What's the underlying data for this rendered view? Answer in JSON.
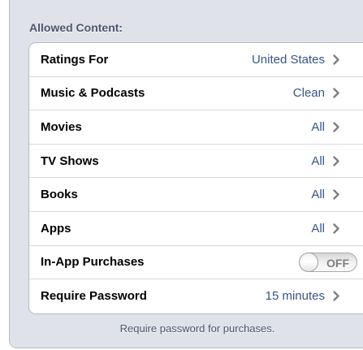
{
  "section": {
    "header": "Allowed Content:",
    "footer": "Require password for purchases."
  },
  "rows": [
    {
      "label": "Ratings For",
      "value": "United States"
    },
    {
      "label": "Music & Podcasts",
      "value": "Clean"
    },
    {
      "label": "Movies",
      "value": "All"
    },
    {
      "label": "TV Shows",
      "value": "All"
    },
    {
      "label": "Books",
      "value": "All"
    },
    {
      "label": "Apps",
      "value": "All"
    },
    {
      "label": "In-App Purchases",
      "toggle_text": "OFF",
      "toggle_on": false
    },
    {
      "label": "Require Password",
      "value": "15 minutes"
    }
  ],
  "colors": {
    "value_text": "#385487",
    "header_text": "#4c566c",
    "chevron": "#7f7f7f"
  },
  "icons": {
    "disclosure": "chevron-right-icon"
  }
}
